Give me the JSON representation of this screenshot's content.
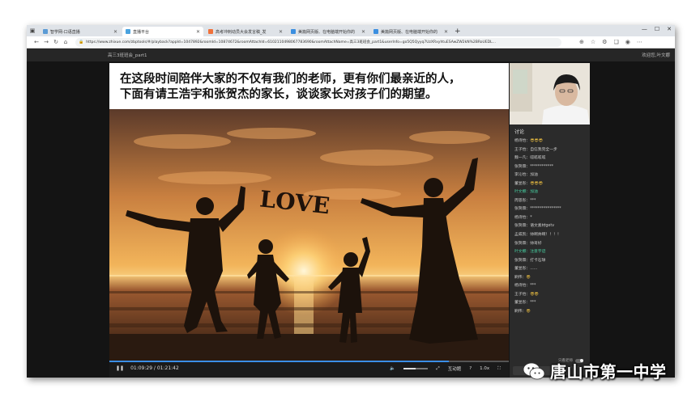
{
  "browser": {
    "tabs": [
      {
        "label": "智学网-口语直播",
        "icon": "page-icon",
        "color": "#5b9bd5",
        "active": false
      },
      {
        "label": "直播平台",
        "icon": "speaker-icon",
        "color": "#4aa3df",
        "active": true
      },
      {
        "label": "高考冲刺动员大会发言稿_发",
        "icon": "doc-icon",
        "color": "#f0713a",
        "active": false
      },
      {
        "label": "美篇网页版、在电脑端开始你的",
        "icon": "meipian-icon",
        "color": "#3b8fe0",
        "active": false
      },
      {
        "label": "美篇网页版、在电脑端开始你的",
        "icon": "meipian-icon",
        "color": "#3b8fe0",
        "active": false
      }
    ],
    "new_tab": "+",
    "url": "https://www.zhixue.com/zbptools/#/playback?appId=1047892&roomId=10874672&roomAttachId=6102110498067783690&roomAttachName=高三3班班会_part1&userInfo=go5Q5Qyyq7UzXRxyhtuESAwZW2kN%2BRoUEDL..."
  },
  "page": {
    "title": "高三3班班会_part1",
    "welcome": "欢迎您,叶文娜"
  },
  "slide": {
    "line1": "在这段时间陪伴大家的不仅有我们的老师，更有你们最亲近的人，",
    "line2": "下面有请王浩宇和张贺杰的家长，谈谈家长对孩子们的期望。",
    "photo_word": "LOVE"
  },
  "player": {
    "current_time": "01:09:29",
    "total_time": "01:21:42",
    "progress": 0.85,
    "volume": 0.5,
    "interaction_label": "互动题",
    "speed": "1.0x"
  },
  "chat": {
    "title": "讨论",
    "messages": [
      {
        "name": "杨诗怡：",
        "text": "",
        "emoji": "😎😎😎",
        "highlight": false
      },
      {
        "name": "王子怡：",
        "text": "自信我完全一步",
        "emoji": "",
        "highlight": false
      },
      {
        "name": "魏一凡：",
        "text": "呱呱呱呱",
        "emoji": "",
        "highlight": false
      },
      {
        "name": "张贺霖：",
        "text": "************",
        "emoji": "",
        "highlight": false
      },
      {
        "name": "李沁怡：",
        "text": "加油",
        "emoji": "",
        "highlight": false
      },
      {
        "name": "董昱彤：",
        "text": "",
        "emoji": "😎😎😎",
        "highlight": false
      },
      {
        "name": "叶文娜：",
        "text": "加油",
        "emoji": "",
        "highlight": true
      },
      {
        "name": "周思彤：",
        "text": "***",
        "emoji": "",
        "highlight": false
      },
      {
        "name": "张贺霖：",
        "text": "****************",
        "emoji": "",
        "highlight": false
      },
      {
        "name": "杨诗怡：",
        "text": "*",
        "emoji": "",
        "highlight": false
      },
      {
        "name": "张贺霖：",
        "text": "语文素材getv",
        "emoji": "",
        "highlight": false
      },
      {
        "name": "孟威凯：",
        "text": "帅啊帅啊！！！！",
        "emoji": "",
        "highlight": false
      },
      {
        "name": "张贺霖：",
        "text": "帅哥好",
        "emoji": "",
        "highlight": false
      },
      {
        "name": "叶文娜：",
        "text": "注意字迹",
        "emoji": "",
        "highlight": true
      },
      {
        "name": "张贺霖：",
        "text": "打卡石球",
        "emoji": "",
        "highlight": false
      },
      {
        "name": "董昱彤：",
        "text": "......",
        "emoji": "",
        "highlight": false
      },
      {
        "name": "刷伟：",
        "text": "",
        "emoji": "😎",
        "highlight": false
      },
      {
        "name": "杨诗怡：",
        "text": "***",
        "emoji": "",
        "highlight": false
      },
      {
        "name": "王子怡：",
        "text": "",
        "emoji": "😎😎",
        "highlight": false
      },
      {
        "name": "董昱彤：",
        "text": "***",
        "emoji": "",
        "highlight": false
      },
      {
        "name": "刷伟：",
        "text": "",
        "emoji": "😎",
        "highlight": false
      }
    ],
    "only_teacher_label": "只看老师"
  },
  "watermark": {
    "text": "唐山市第一中学",
    "icon": "wechat-icon"
  }
}
